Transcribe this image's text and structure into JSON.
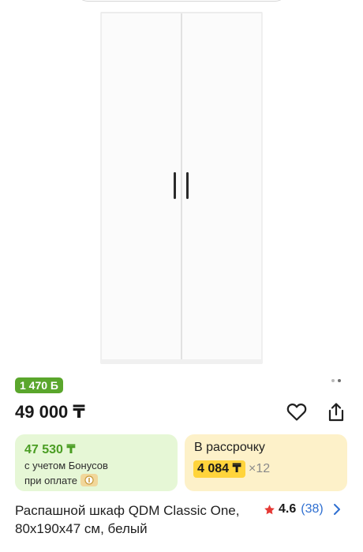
{
  "product": {
    "bonus_badge": "1 470 Б",
    "price": "49 000 ₸",
    "title": "Распашной шкаф QDM Classic One, 80x190x47 см, белый",
    "rating": "4.6",
    "reviews": "(38)"
  },
  "bonus_card": {
    "price": "47 530 ₸",
    "line1": "с учетом Бонусов",
    "line2": "при оплате"
  },
  "installment_card": {
    "title": "В рассрочку",
    "amount": "4 084 ₸",
    "multiplier": "×12"
  },
  "gallery": {
    "current_page": 2,
    "total_pages": 2
  },
  "colors": {
    "accent_green": "#5aa62c",
    "bonus_bg": "#e6f7d6",
    "installment_bg": "#fdf1c9",
    "installment_highlight": "#ffd43b",
    "link_blue": "#2f6fd1",
    "star_red": "#e53935"
  },
  "icons": [
    "heart-icon",
    "share-icon",
    "star-icon",
    "chevron-right-icon",
    "coin-icon"
  ]
}
